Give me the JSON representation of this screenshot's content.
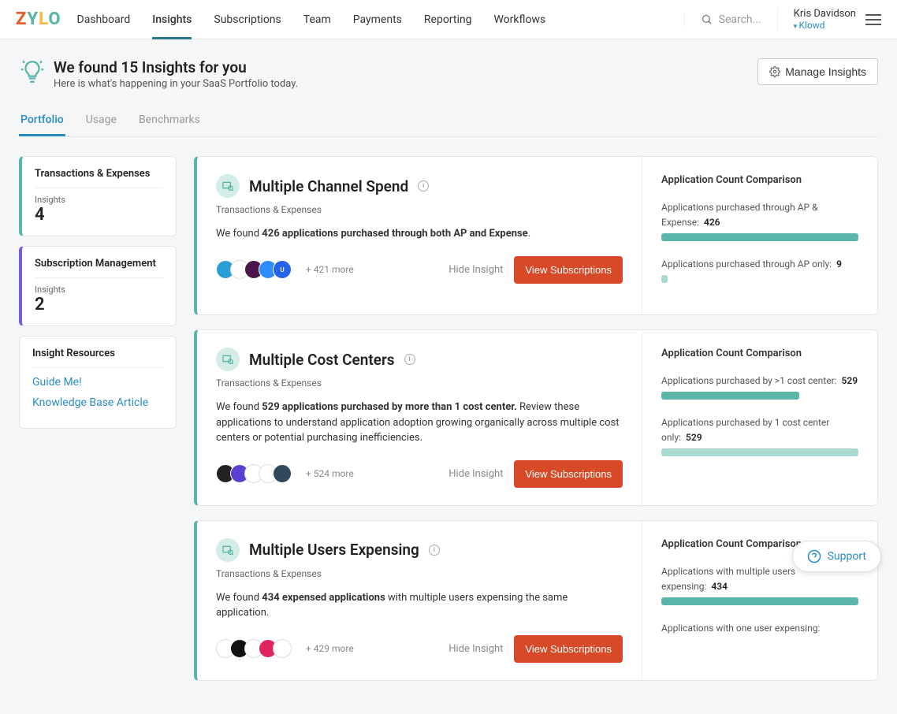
{
  "nav": {
    "items": [
      "Dashboard",
      "Insights",
      "Subscriptions",
      "Team",
      "Payments",
      "Reporting",
      "Workflows"
    ],
    "active": 1
  },
  "search": {
    "placeholder": "Search..."
  },
  "user": {
    "name": "Kris Davidson",
    "org": "Klowd"
  },
  "header": {
    "title": "We found 15 Insights for you",
    "subtitle": "Here is what's happening in your SaaS Portfolio today.",
    "manage_btn": "Manage Insights"
  },
  "tabs": {
    "items": [
      "Portfolio",
      "Usage",
      "Benchmarks"
    ],
    "active": 0
  },
  "sidebar": {
    "groups": [
      {
        "title": "Transactions & Expenses",
        "label": "Insights",
        "count": "4",
        "accent": "teal"
      },
      {
        "title": "Subscription Management",
        "label": "Insights",
        "count": "2",
        "accent": "purple"
      }
    ],
    "resources_title": "Insight Resources",
    "links": [
      "Guide Me!",
      "Knowledge Base Article"
    ]
  },
  "insights": [
    {
      "title": "Multiple Channel Spend",
      "category": "Transactions & Expenses",
      "desc_pre": "We found ",
      "desc_bold": "426 applications purchased through both AP and Expense",
      "desc_post": ".",
      "more": "+ 421 more",
      "hide": "Hide Insight",
      "btn": "View Subscriptions",
      "avatars": [
        {
          "bg": "#2a9fd6",
          "txt": ""
        },
        {
          "bg": "#fff",
          "txt": "",
          "border": "#ddd"
        },
        {
          "bg": "#4a154b",
          "txt": ""
        },
        {
          "bg": "#2d8cff",
          "txt": ""
        },
        {
          "bg": "#2563eb",
          "txt": "U"
        }
      ],
      "comp_title": "Application Count Comparison",
      "m1_label": "Applications purchased through AP & Expense:",
      "m1_val": "426",
      "m1_bar_w": "100%",
      "m2_label": "Applications purchased through AP only:",
      "m2_val": "9",
      "m2_bar_w": "3%"
    },
    {
      "title": "Multiple Cost Centers",
      "category": "Transactions & Expenses",
      "desc_pre": "We found ",
      "desc_bold": "529 applications purchased by more than 1 cost center.",
      "desc_post": " Review these applications to understand application adoption growing organically across multiple cost centers or potential purchasing inefficiencies.",
      "more": "+ 524 more",
      "hide": "Hide Insight",
      "btn": "View Subscriptions",
      "avatars": [
        {
          "bg": "#222",
          "txt": ""
        },
        {
          "bg": "#5b3fd1",
          "txt": ""
        },
        {
          "bg": "#fff",
          "txt": "",
          "border": "#ddd"
        },
        {
          "bg": "#fff",
          "txt": "",
          "border": "#ddd"
        },
        {
          "bg": "#2e4a5c",
          "txt": ""
        }
      ],
      "comp_title": "Application Count Comparison",
      "m1_label": "Applications purchased by >1 cost center:",
      "m1_val": "529",
      "m1_bar_w": "70%",
      "m2_label": "Applications purchased by 1 cost center only:",
      "m2_val": "529",
      "m2_bar_w": "100%"
    },
    {
      "title": "Multiple Users Expensing",
      "category": "Transactions & Expenses",
      "desc_pre": "We found ",
      "desc_bold": "434 expensed applications",
      "desc_post": " with multiple users expensing the same application.",
      "more": "+ 429 more",
      "hide": "Hide Insight",
      "btn": "View Subscriptions",
      "avatars": [
        {
          "bg": "#fff",
          "txt": "",
          "border": "#ddd"
        },
        {
          "bg": "#111",
          "txt": ""
        },
        {
          "bg": "#fff",
          "txt": "",
          "border": "#ddd"
        },
        {
          "bg": "#e0245e",
          "txt": ""
        },
        {
          "bg": "#fff",
          "txt": "",
          "border": "#ddd"
        }
      ],
      "comp_title": "Application Count Comparison",
      "m1_label": "Applications with multiple users expensing:",
      "m1_val": "434",
      "m1_bar_w": "100%",
      "m2_label": "Applications with one user expensing:",
      "m2_val": "",
      "m2_bar_w": "0%"
    }
  ],
  "support": "Support"
}
